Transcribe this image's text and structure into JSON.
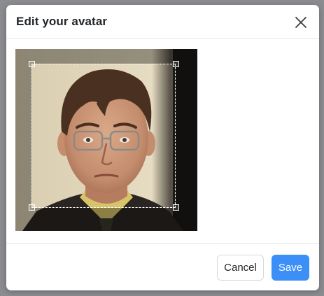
{
  "dialog": {
    "title": "Edit your avatar",
    "close_icon": "close-icon"
  },
  "footer": {
    "cancel_label": "Cancel",
    "save_label": "Save"
  },
  "colors": {
    "primary": "#3b8ff7",
    "title_text": "#212529"
  }
}
